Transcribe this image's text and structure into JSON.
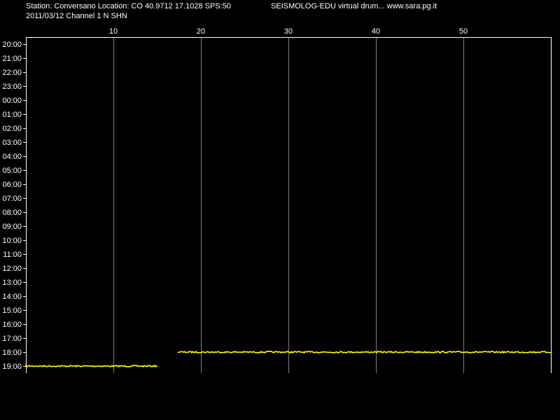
{
  "header": {
    "station_info": "Station: Conversano Location: CO 40.9712 17.1028 SPS:50",
    "program_info": "SEISMOLOG-EDU virtual drum... www.sara.pg.it",
    "date_channel": "2011/03/12  Channel 1 N SHN"
  },
  "colors": {
    "background": "#000000",
    "frame": "#ffffff",
    "gridlines": "#808080",
    "trace": "#ffff00",
    "text": "#ffffff"
  },
  "chart_data": {
    "type": "line",
    "xlabel": "",
    "ylabel": "",
    "x_ticks": [
      10,
      20,
      30,
      40,
      50
    ],
    "xlim": [
      0,
      60
    ],
    "y_tick_labels": [
      "20:00",
      "21:00",
      "22:00",
      "23:00",
      "00:00",
      "01:00",
      "02:00",
      "03:00",
      "04:00",
      "05:00",
      "06:00",
      "07:00",
      "08:00",
      "09:00",
      "10:00",
      "11:00",
      "12:00",
      "13:00",
      "14:00",
      "15:00",
      "16:00",
      "17:00",
      "18:00",
      "19:00"
    ],
    "grid": "vertical lines at x ticks",
    "series": [
      {
        "row": "19:00",
        "x_start": 0,
        "x_end": 15
      },
      {
        "row": "18:00",
        "x_start": 17.4,
        "x_end": 60
      }
    ]
  }
}
